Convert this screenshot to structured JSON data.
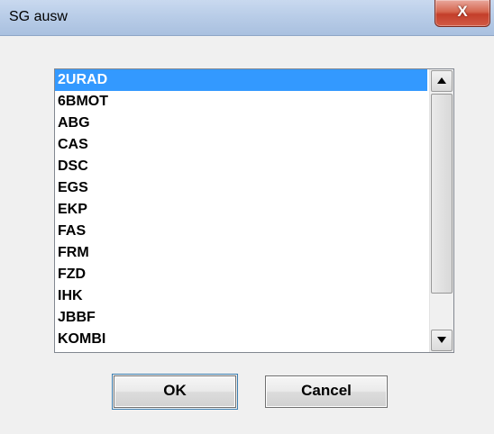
{
  "window": {
    "title": "SG ausw",
    "close_glyph": "X"
  },
  "listbox": {
    "selected_index": 0,
    "items": [
      "2URAD",
      "6BMOT",
      "ABG",
      "CAS",
      "DSC",
      "EGS",
      "EKP",
      "FAS",
      "FRM",
      "FZD",
      "IHK",
      "JBBF",
      "KOMBI"
    ]
  },
  "buttons": {
    "ok_label": "OK",
    "cancel_label": "Cancel"
  },
  "colors": {
    "selection": "#3399ff",
    "close_button": "#c33e2a"
  }
}
